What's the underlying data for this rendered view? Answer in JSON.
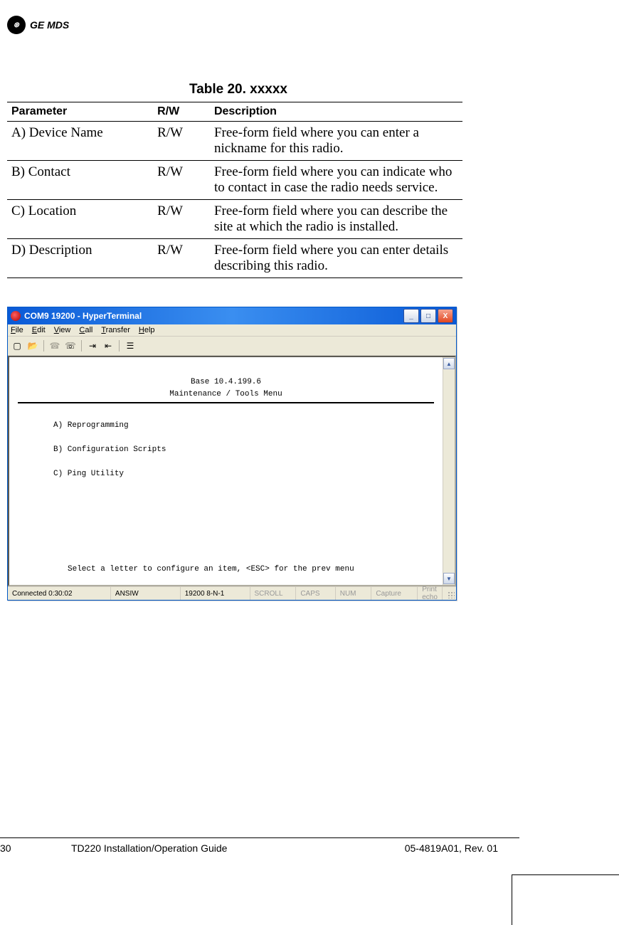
{
  "logo": {
    "monogram": "⊛",
    "brand": "GE MDS"
  },
  "table": {
    "title": "Table 20. xxxxx",
    "headers": {
      "param": "Parameter",
      "rw": "R/W",
      "desc": "Description"
    },
    "rows": [
      {
        "param": "A) Device Name",
        "rw": "R/W",
        "desc": "Free-form field where you can enter a nickname for this radio."
      },
      {
        "param": "B) Contact",
        "rw": "R/W",
        "desc": "Free-form field where you can indicate who to contact in case the radio needs service."
      },
      {
        "param": "C) Location",
        "rw": "R/W",
        "desc": "Free-form field where you can describe the site at which the radio is installed."
      },
      {
        "param": "D) Description",
        "rw": "R/W",
        "desc": "Free-form field where you can enter details describing this radio."
      }
    ]
  },
  "ht": {
    "title": "COM9 19200 - HyperTerminal",
    "menus": {
      "file": "File",
      "edit": "Edit",
      "view": "View",
      "call": "Call",
      "transfer": "Transfer",
      "help": "Help"
    },
    "win_controls": {
      "min": "_",
      "max": "□",
      "close": "X"
    },
    "terminal": {
      "header1": "Base 10.4.199.6",
      "header2": "Maintenance / Tools Menu",
      "items": {
        "a": "A) Reprogramming",
        "b": "B) Configuration Scripts",
        "c": "C) Ping Utility"
      },
      "prompt": "Select a letter to configure an item, <ESC> for the prev menu"
    },
    "status": {
      "conn": "Connected 0:30:02",
      "emul": "ANSIW",
      "settings": "19200 8-N-1",
      "scroll": "SCROLL",
      "caps": "CAPS",
      "num": "NUM",
      "capture": "Capture",
      "echo": "Print echo"
    }
  },
  "footer": {
    "page": "30",
    "title": "TD220 Installation/Operation Guide",
    "rev": "05-4819A01, Rev. 01"
  }
}
